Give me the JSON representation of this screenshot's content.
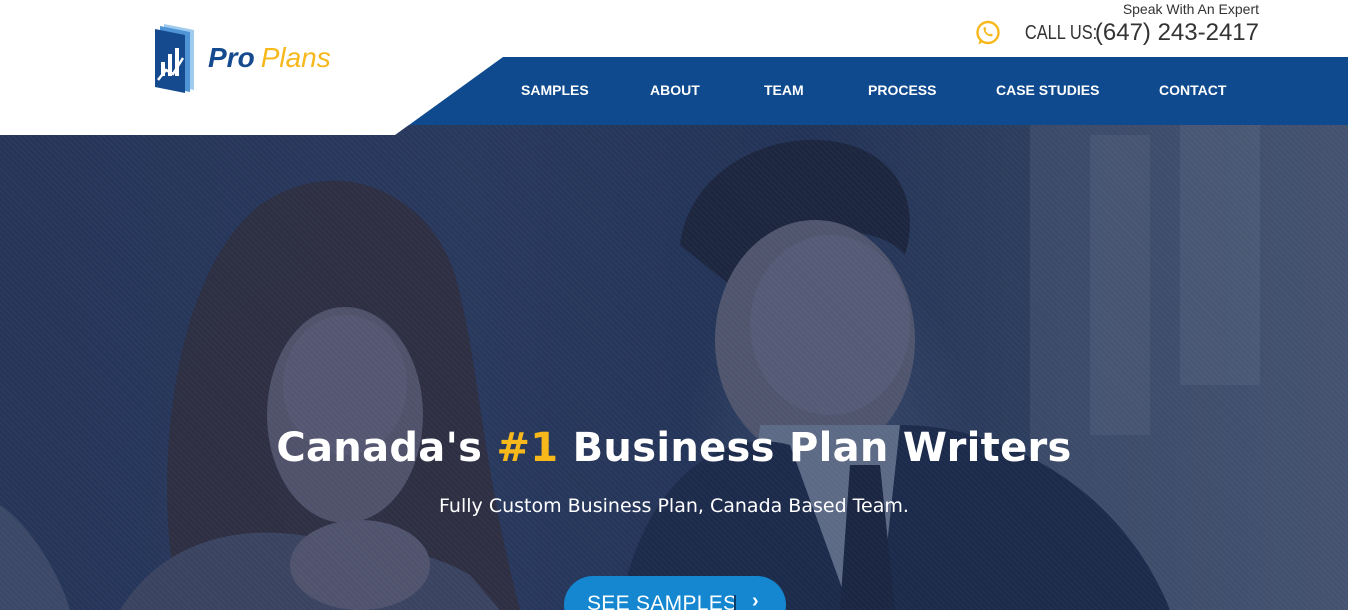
{
  "header": {
    "brand": {
      "part1": "Pro",
      "part2": "Plans"
    },
    "expert_text": "Speak With An Expert",
    "call_label": "CALL US:",
    "phone": "(647) 243-2417",
    "phone_icon": "whatsapp-icon"
  },
  "nav": {
    "items": [
      {
        "label": "SAMPLES"
      },
      {
        "label": "ABOUT"
      },
      {
        "label": "TEAM"
      },
      {
        "label": "PROCESS"
      },
      {
        "label": "CASE STUDIES"
      },
      {
        "label": "CONTACT"
      }
    ]
  },
  "hero": {
    "headline_before": "Canada's ",
    "headline_highlight": "#1",
    "headline_after": " Business Plan Writers",
    "subheading": "Fully Custom Business Plan, Canada Based Team.",
    "cta_label": "SEE SAMPLES",
    "cta_icon": "chevron-right-icon"
  },
  "colors": {
    "brand_blue": "#164a8e",
    "accent_yellow": "#f6b81b",
    "cta_blue": "#1487d0"
  }
}
